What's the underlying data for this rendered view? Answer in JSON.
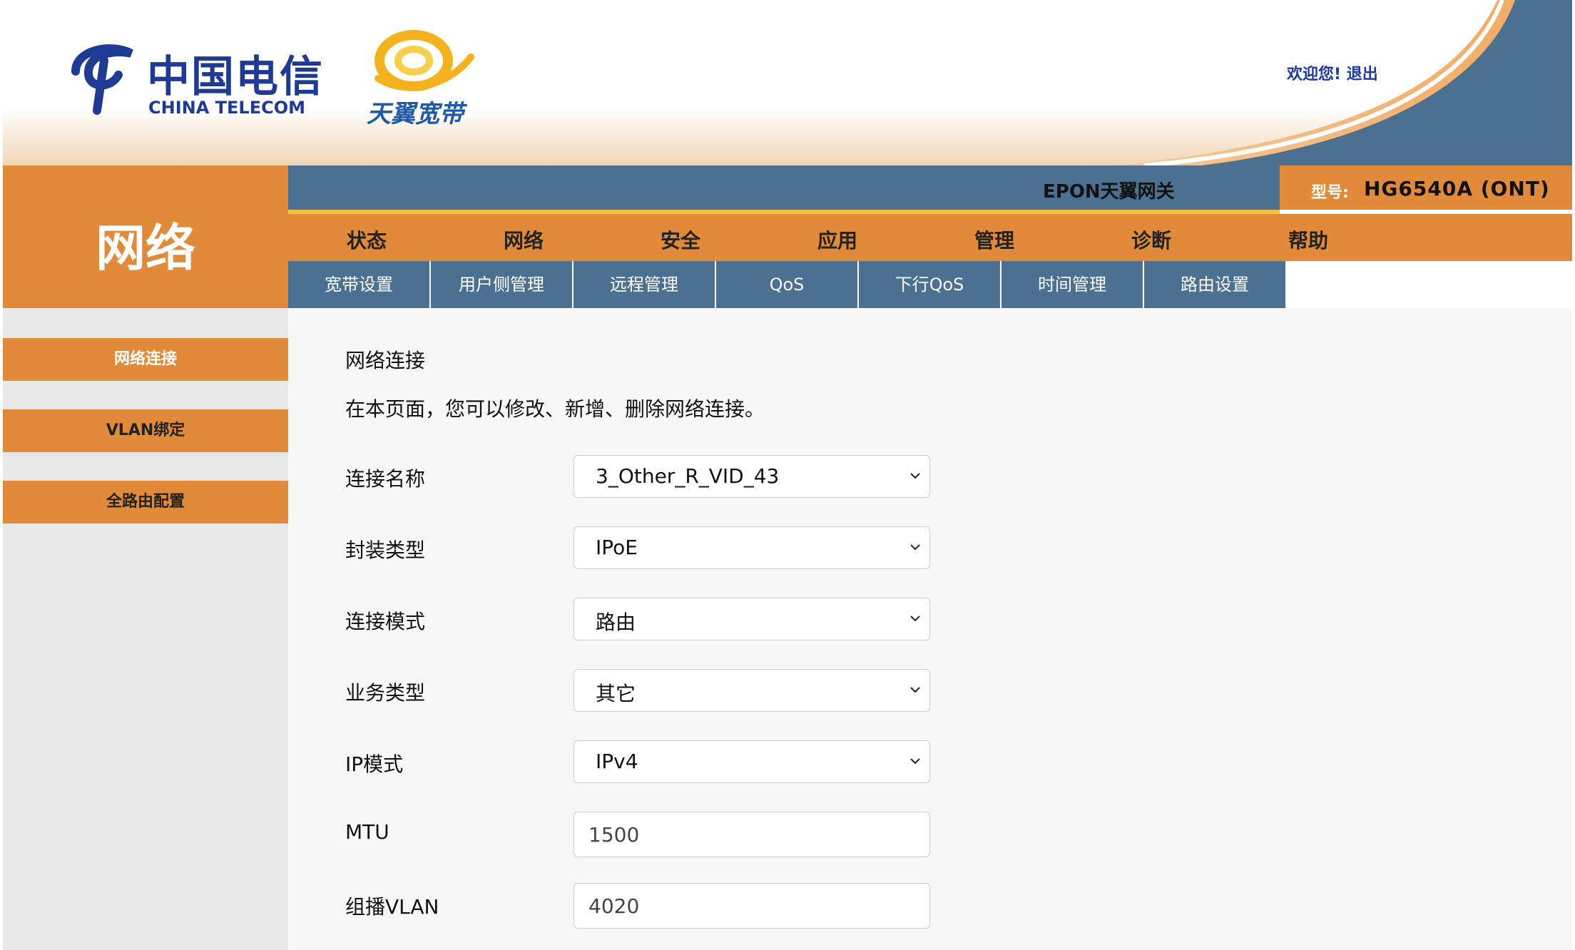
{
  "header": {
    "brand_cn": "中国电信",
    "brand_en": "CHINA TELECOM",
    "broadband_brand": "天翼宽带",
    "welcome": "欢迎您!",
    "logout": "退出",
    "gateway_name": "EPON天翼网关",
    "model_label": "型号:",
    "model_value": "HG6540A (ONT)"
  },
  "section_title": "网络",
  "main_nav": [
    "状态",
    "网络",
    "安全",
    "应用",
    "管理",
    "诊断",
    "帮助"
  ],
  "sub_nav": [
    "宽带设置",
    "用户侧管理",
    "远程管理",
    "QoS",
    "下行QoS",
    "时间管理",
    "路由设置"
  ],
  "sidebar": [
    "网络连接",
    "VLAN绑定",
    "全路由配置"
  ],
  "content": {
    "title": "网络连接",
    "description": "在本页面，您可以修改、新增、删除网络连接。",
    "fields": [
      {
        "label": "连接名称",
        "value": "3_Other_R_VID_43",
        "type": "select"
      },
      {
        "label": "封装类型",
        "value": "IPoE",
        "type": "select"
      },
      {
        "label": "连接模式",
        "value": "路由",
        "type": "select"
      },
      {
        "label": "业务类型",
        "value": "其它",
        "type": "select"
      },
      {
        "label": "IP模式",
        "value": "IPv4",
        "type": "select"
      },
      {
        "label": "MTU",
        "value": "1500",
        "type": "input"
      },
      {
        "label": "组播VLAN",
        "value": "4020",
        "type": "input"
      }
    ]
  },
  "colors": {
    "orange": "#e08a3a",
    "blue": "#4b7091",
    "yellow": "#f2c240",
    "brand_blue": "#1e3a93"
  }
}
